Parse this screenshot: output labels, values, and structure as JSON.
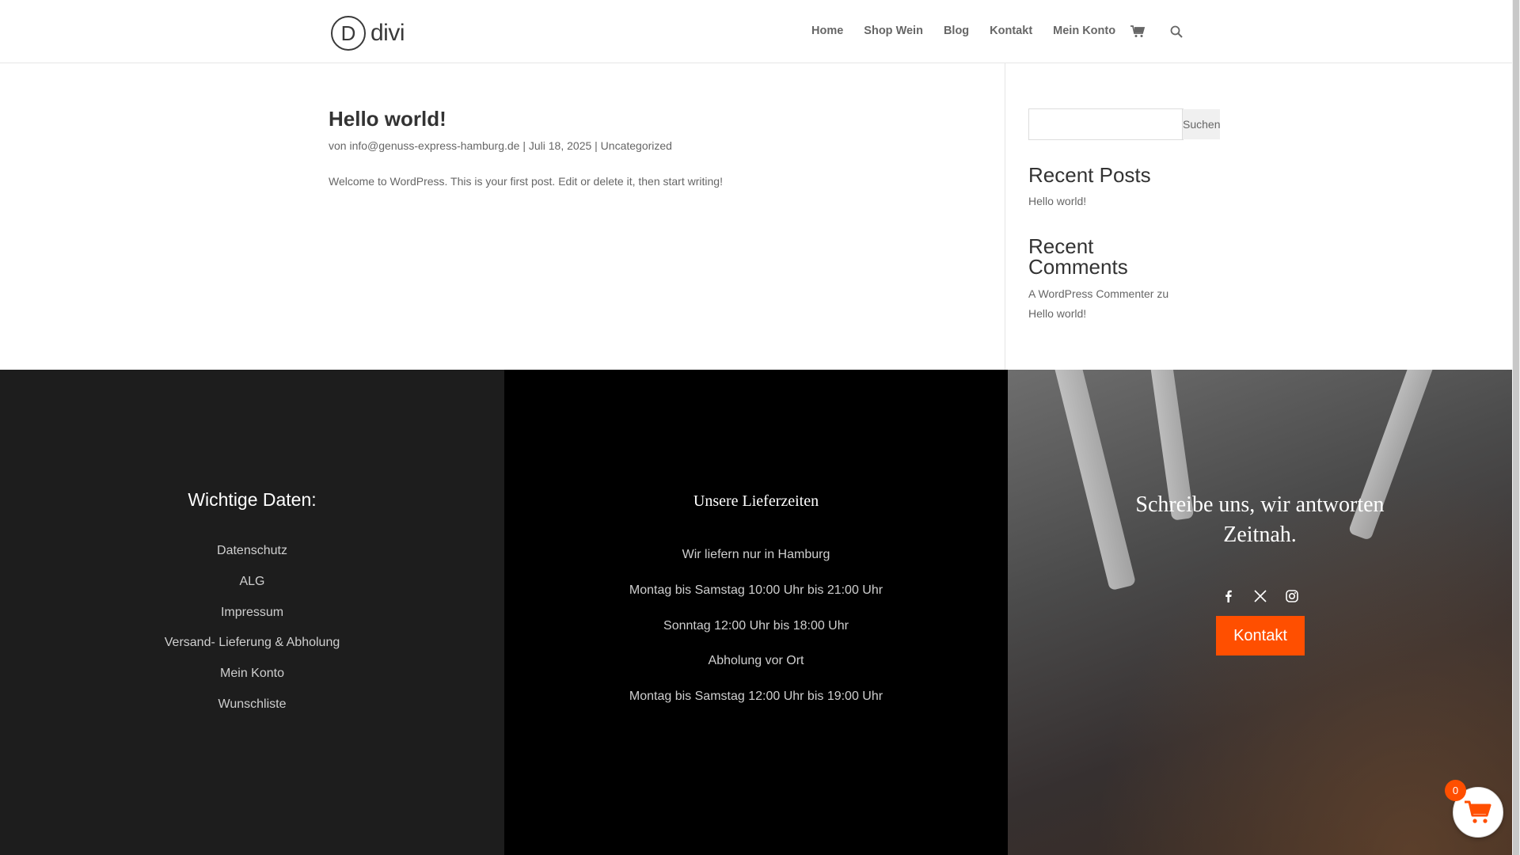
{
  "header": {
    "logo_text": "divi",
    "logo_letter": "D",
    "nav": [
      "Home",
      "Shop Wein",
      "Blog",
      "Kontakt",
      "Mein Konto"
    ]
  },
  "post": {
    "title": "Hello world!",
    "meta": "von info@genuss-express-hamburg.de | Juli 18, 2025 | Uncategorized",
    "excerpt": "Welcome to WordPress. This is your first post. Edit or delete it, then start writing!"
  },
  "sidebar": {
    "search_button": "Suchen",
    "recent_posts_title": "Recent Posts",
    "recent_posts": [
      "Hello world!"
    ],
    "recent_comments_title_1": "Recent",
    "recent_comments_title_2": "Comments",
    "recent_comment_line1": "A WordPress Commenter zu",
    "recent_comment_line2": "Hello world!"
  },
  "footer": {
    "col1": {
      "title": "Wichtige Daten:",
      "links": [
        "Datenschutz",
        "ALG",
        "Impressum",
        "Versand- Lieferung & Abholung",
        "Mein Konto",
        "Wunschliste"
      ]
    },
    "col2": {
      "title": "Unsere Lieferzeiten",
      "lines": [
        "Wir liefern nur in Hamburg",
        "Montag bis Samstag 10:00 Uhr bis 21:00 Uhr",
        "Sonntag 12:00 Uhr bis 18:00 Uhr",
        "Abholung vor Ort",
        "Montag bis Samstag 12:00 Uhr bis 19:00 Uhr"
      ]
    },
    "col3": {
      "title": "Schreibe uns, wir antworten Zeitnah.",
      "social_icons": [
        "facebook-icon",
        "x-icon",
        "instagram-icon"
      ],
      "button": "Kontakt"
    }
  },
  "cart": {
    "count": "0"
  },
  "colors": {
    "accent": "#ff4f00",
    "dark": "#1d1d1d",
    "black": "#000000"
  }
}
